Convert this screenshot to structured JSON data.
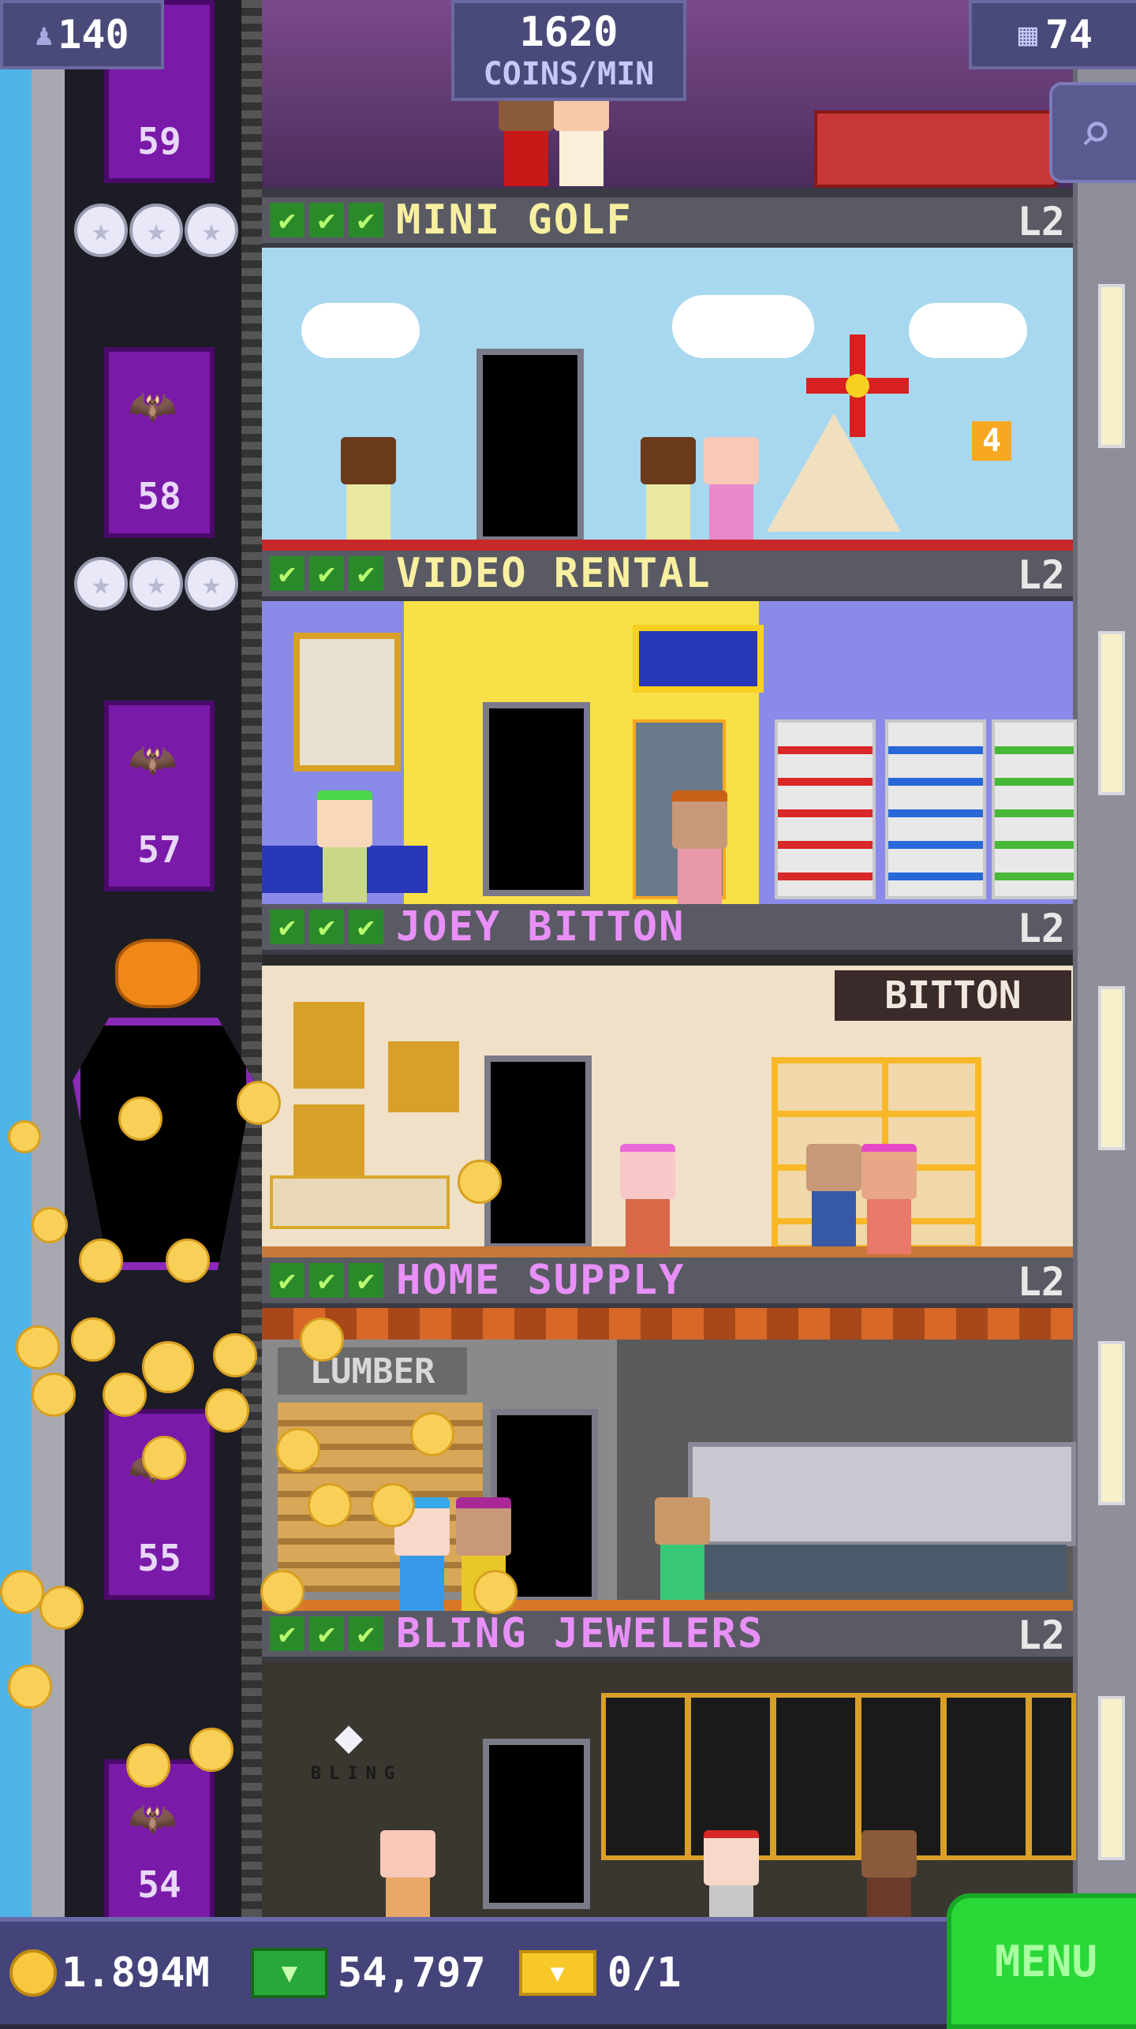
{
  "hud": {
    "population": "140",
    "coins_per_min_value": "1620",
    "coins_per_min_label": "COINS/MIN",
    "floor_count": "74"
  },
  "floors": [
    {
      "name": "MINI GOLF",
      "level": "L2",
      "color": "#f8f0a0",
      "elevator_number": "58",
      "sign": "4"
    },
    {
      "name": "VIDEO RENTAL",
      "level": "L2",
      "color": "#f8f0a0",
      "elevator_number": "57"
    },
    {
      "name": "JOEY BITTON",
      "level": "L2",
      "color": "#e890f8",
      "elevator_number": "",
      "sign": "BITTON"
    },
    {
      "name": "HOME SUPPLY",
      "level": "L2",
      "color": "#e890f8",
      "elevator_number": "55",
      "sign": "LUMBER"
    },
    {
      "name": "BLING JEWELERS",
      "level": "L2",
      "color": "#e890f8",
      "elevator_number": "54",
      "sign": "BLING"
    }
  ],
  "top_floor": {
    "elevator_number": "59"
  },
  "bottom": {
    "coins": "1.894M",
    "bux": "54,797",
    "tickets": "0/1",
    "menu_label": "MENU"
  },
  "checks": [
    "✔",
    "✔",
    "✔"
  ]
}
